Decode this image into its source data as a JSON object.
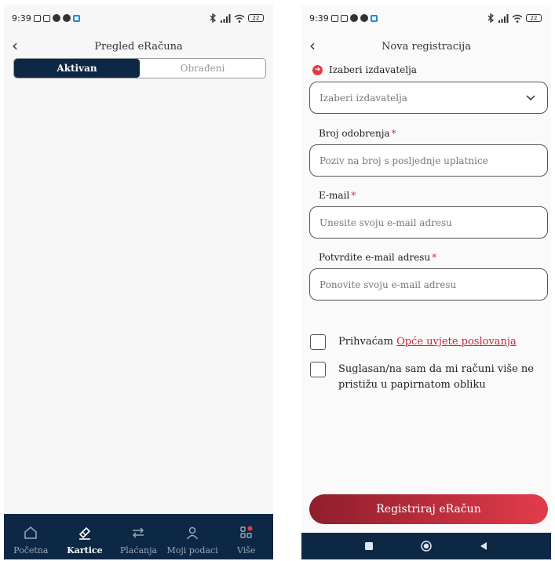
{
  "left_screen": {
    "status": {
      "time": "9:39",
      "battery": "22"
    },
    "title": "Pregled eRačuna",
    "tabs": [
      {
        "label": "Aktivan",
        "active": true
      },
      {
        "label": "Obrađeni",
        "active": false
      }
    ],
    "tabbar": [
      {
        "label": "Početna",
        "icon": "home-icon",
        "active": false
      },
      {
        "label": "Kartice",
        "icon": "card-icon",
        "active": true
      },
      {
        "label": "Plaćanja",
        "icon": "transfer-icon",
        "active": false
      },
      {
        "label": "Moji podaci",
        "icon": "user-icon",
        "active": false
      },
      {
        "label": "Više",
        "icon": "grid-icon",
        "active": false
      }
    ]
  },
  "right_screen": {
    "status": {
      "time": "9:39",
      "battery": "22"
    },
    "title": "Nova registracija",
    "issuer": {
      "label": "Izaberi izdavatelja",
      "placeholder": "Izaberi izdavatelja"
    },
    "fields": [
      {
        "label": "Broj odobrenja",
        "placeholder": "Poziv na broj s posljednje uplatnice"
      },
      {
        "label": "E-mail",
        "placeholder": "Unesite svoju e-mail adresu"
      },
      {
        "label": "Potvrdite e-mail adresu",
        "placeholder": "Ponovite svoju e-mail adresu"
      }
    ],
    "required_mark": "*",
    "checkboxes": {
      "terms_prefix": "Prihvaćam ",
      "terms_link": "Opće uvjete poslovanja",
      "paperless": "Suglasan/na sam da mi računi više ne pristižu u papirnatom obliku"
    },
    "submit_label": "Registriraj eRačun"
  },
  "colors": {
    "navy": "#0d2845",
    "accent_red": "#e23b4b",
    "accent_dark_red": "#8f1e2c",
    "link_red": "#c62838"
  }
}
